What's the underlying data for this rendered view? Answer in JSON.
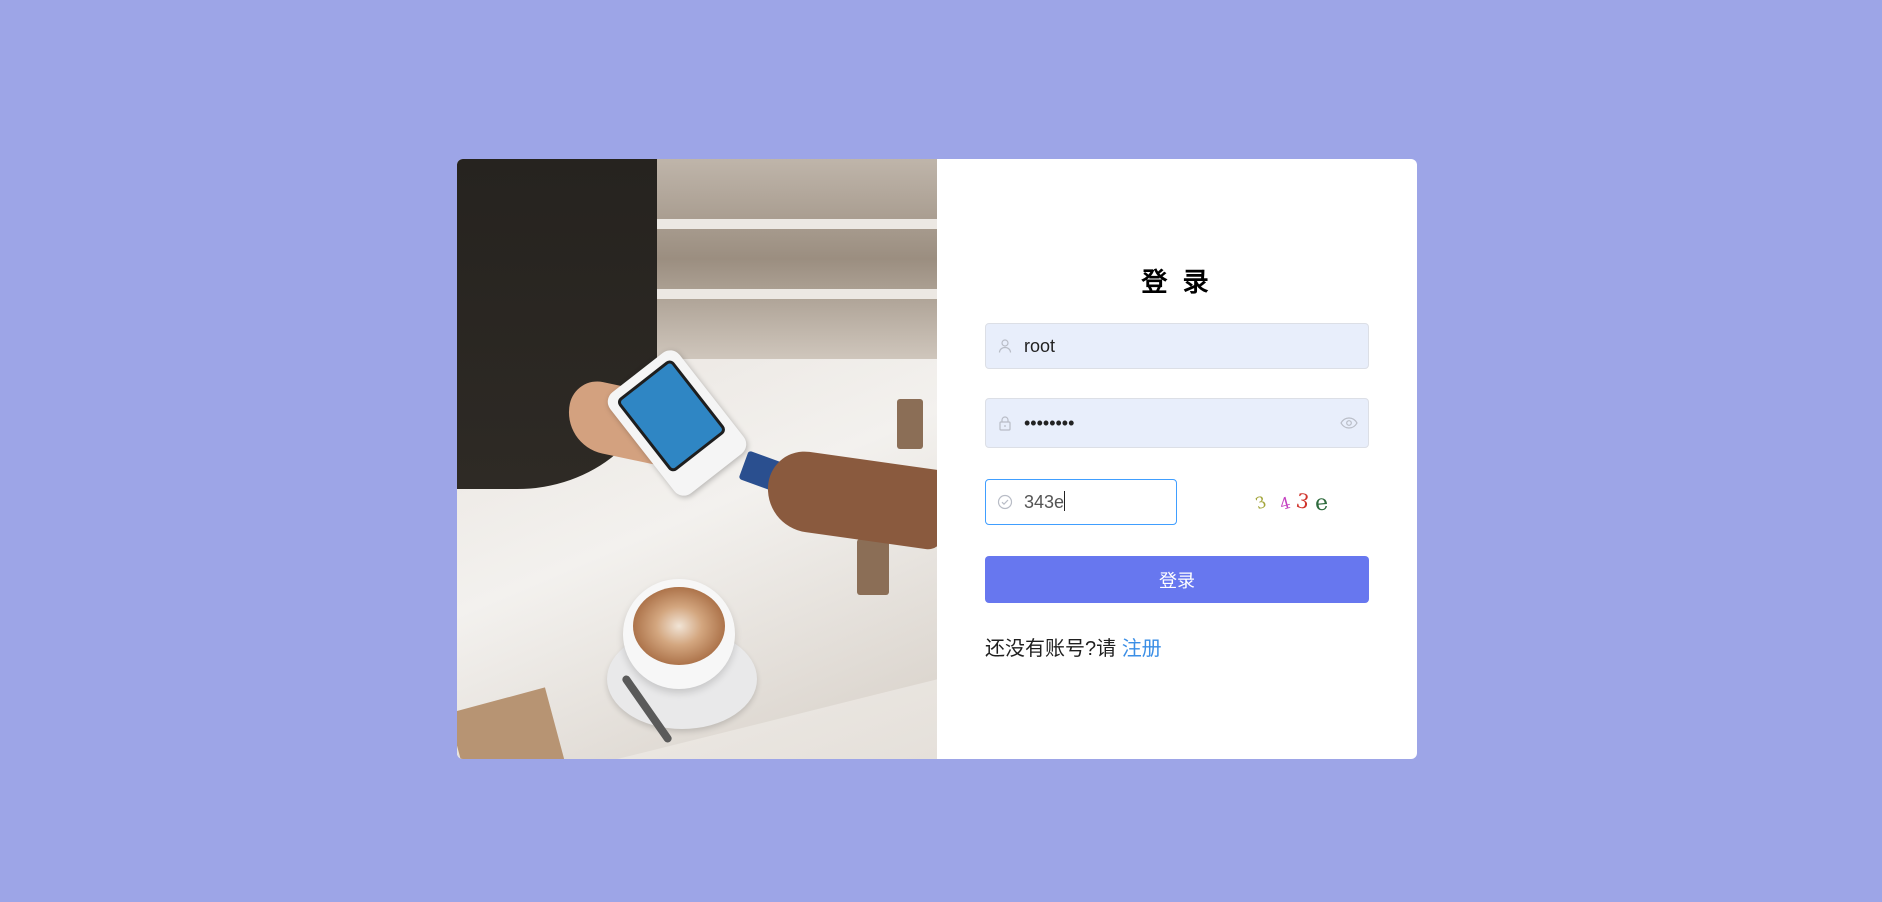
{
  "page": {
    "background_color": "#9da5e7"
  },
  "login": {
    "title": "登 录",
    "username": {
      "value": "root",
      "icon": "user-icon"
    },
    "password": {
      "value": "••••••••",
      "icon": "lock-icon",
      "toggle_icon": "eye-icon"
    },
    "captcha_input": {
      "value": "343e",
      "icon": "check-circle-icon"
    },
    "captcha_image": {
      "chars": [
        "3",
        "4",
        "3",
        "e"
      ],
      "colors": [
        "#a3a53a",
        "#c43fc0",
        "#d0342c",
        "#2e6b3d"
      ]
    },
    "submit_label": "登录",
    "accent_color": "#6777ef",
    "register_prompt": "还没有账号?请 ",
    "register_link": "注册"
  }
}
